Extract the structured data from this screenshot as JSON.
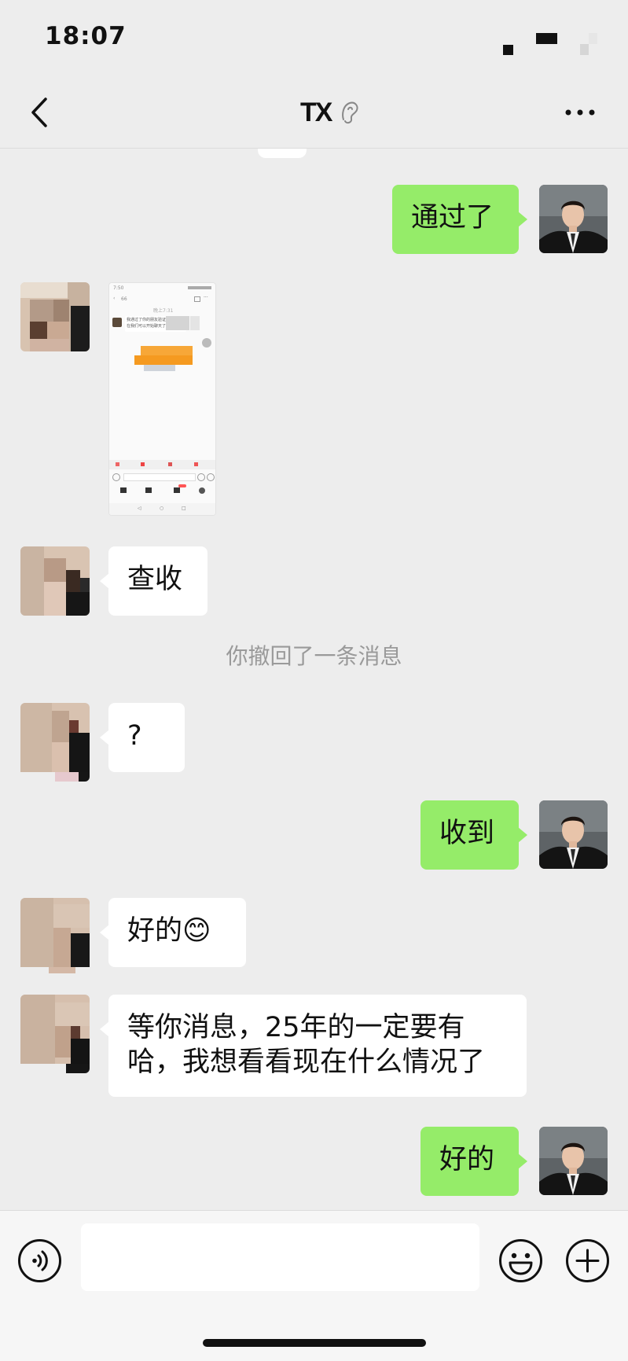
{
  "status_bar": {
    "time": "18:07"
  },
  "nav": {
    "title": "TX"
  },
  "messages": [
    {
      "id": "m1",
      "side": "me",
      "text": "通过了"
    },
    {
      "id": "m2",
      "side": "other",
      "type": "image"
    },
    {
      "id": "m3",
      "side": "other",
      "text": "查收"
    },
    {
      "id": "m4",
      "type": "system",
      "text": "你撤回了一条消息"
    },
    {
      "id": "m5",
      "side": "other",
      "text": "?"
    },
    {
      "id": "m6",
      "side": "me",
      "text": "收到"
    },
    {
      "id": "m7",
      "side": "other",
      "text": "好的😊"
    },
    {
      "id": "m8",
      "side": "other",
      "lines": [
        "等你消息，25年的一定要有",
        "哈，我想看看现在什么情况了"
      ]
    },
    {
      "id": "m9",
      "side": "me",
      "text": "好的"
    }
  ],
  "image_message": {
    "status_time": "7:50",
    "header": "66",
    "timestamp": "晚上7:31",
    "bubble_line1": "我通过了你的朋友验证请求，现",
    "bubble_line2": "在我们可以开始聊天了"
  },
  "input_bar": {
    "value": "",
    "placeholder": ""
  },
  "colors": {
    "me_bubble": "#95ec69",
    "other_bubble": "#ffffff",
    "background": "#ededed"
  },
  "icons": [
    "back-icon",
    "mute-icon",
    "more-icon",
    "voice-icon",
    "emoji-icon",
    "plus-icon"
  ]
}
